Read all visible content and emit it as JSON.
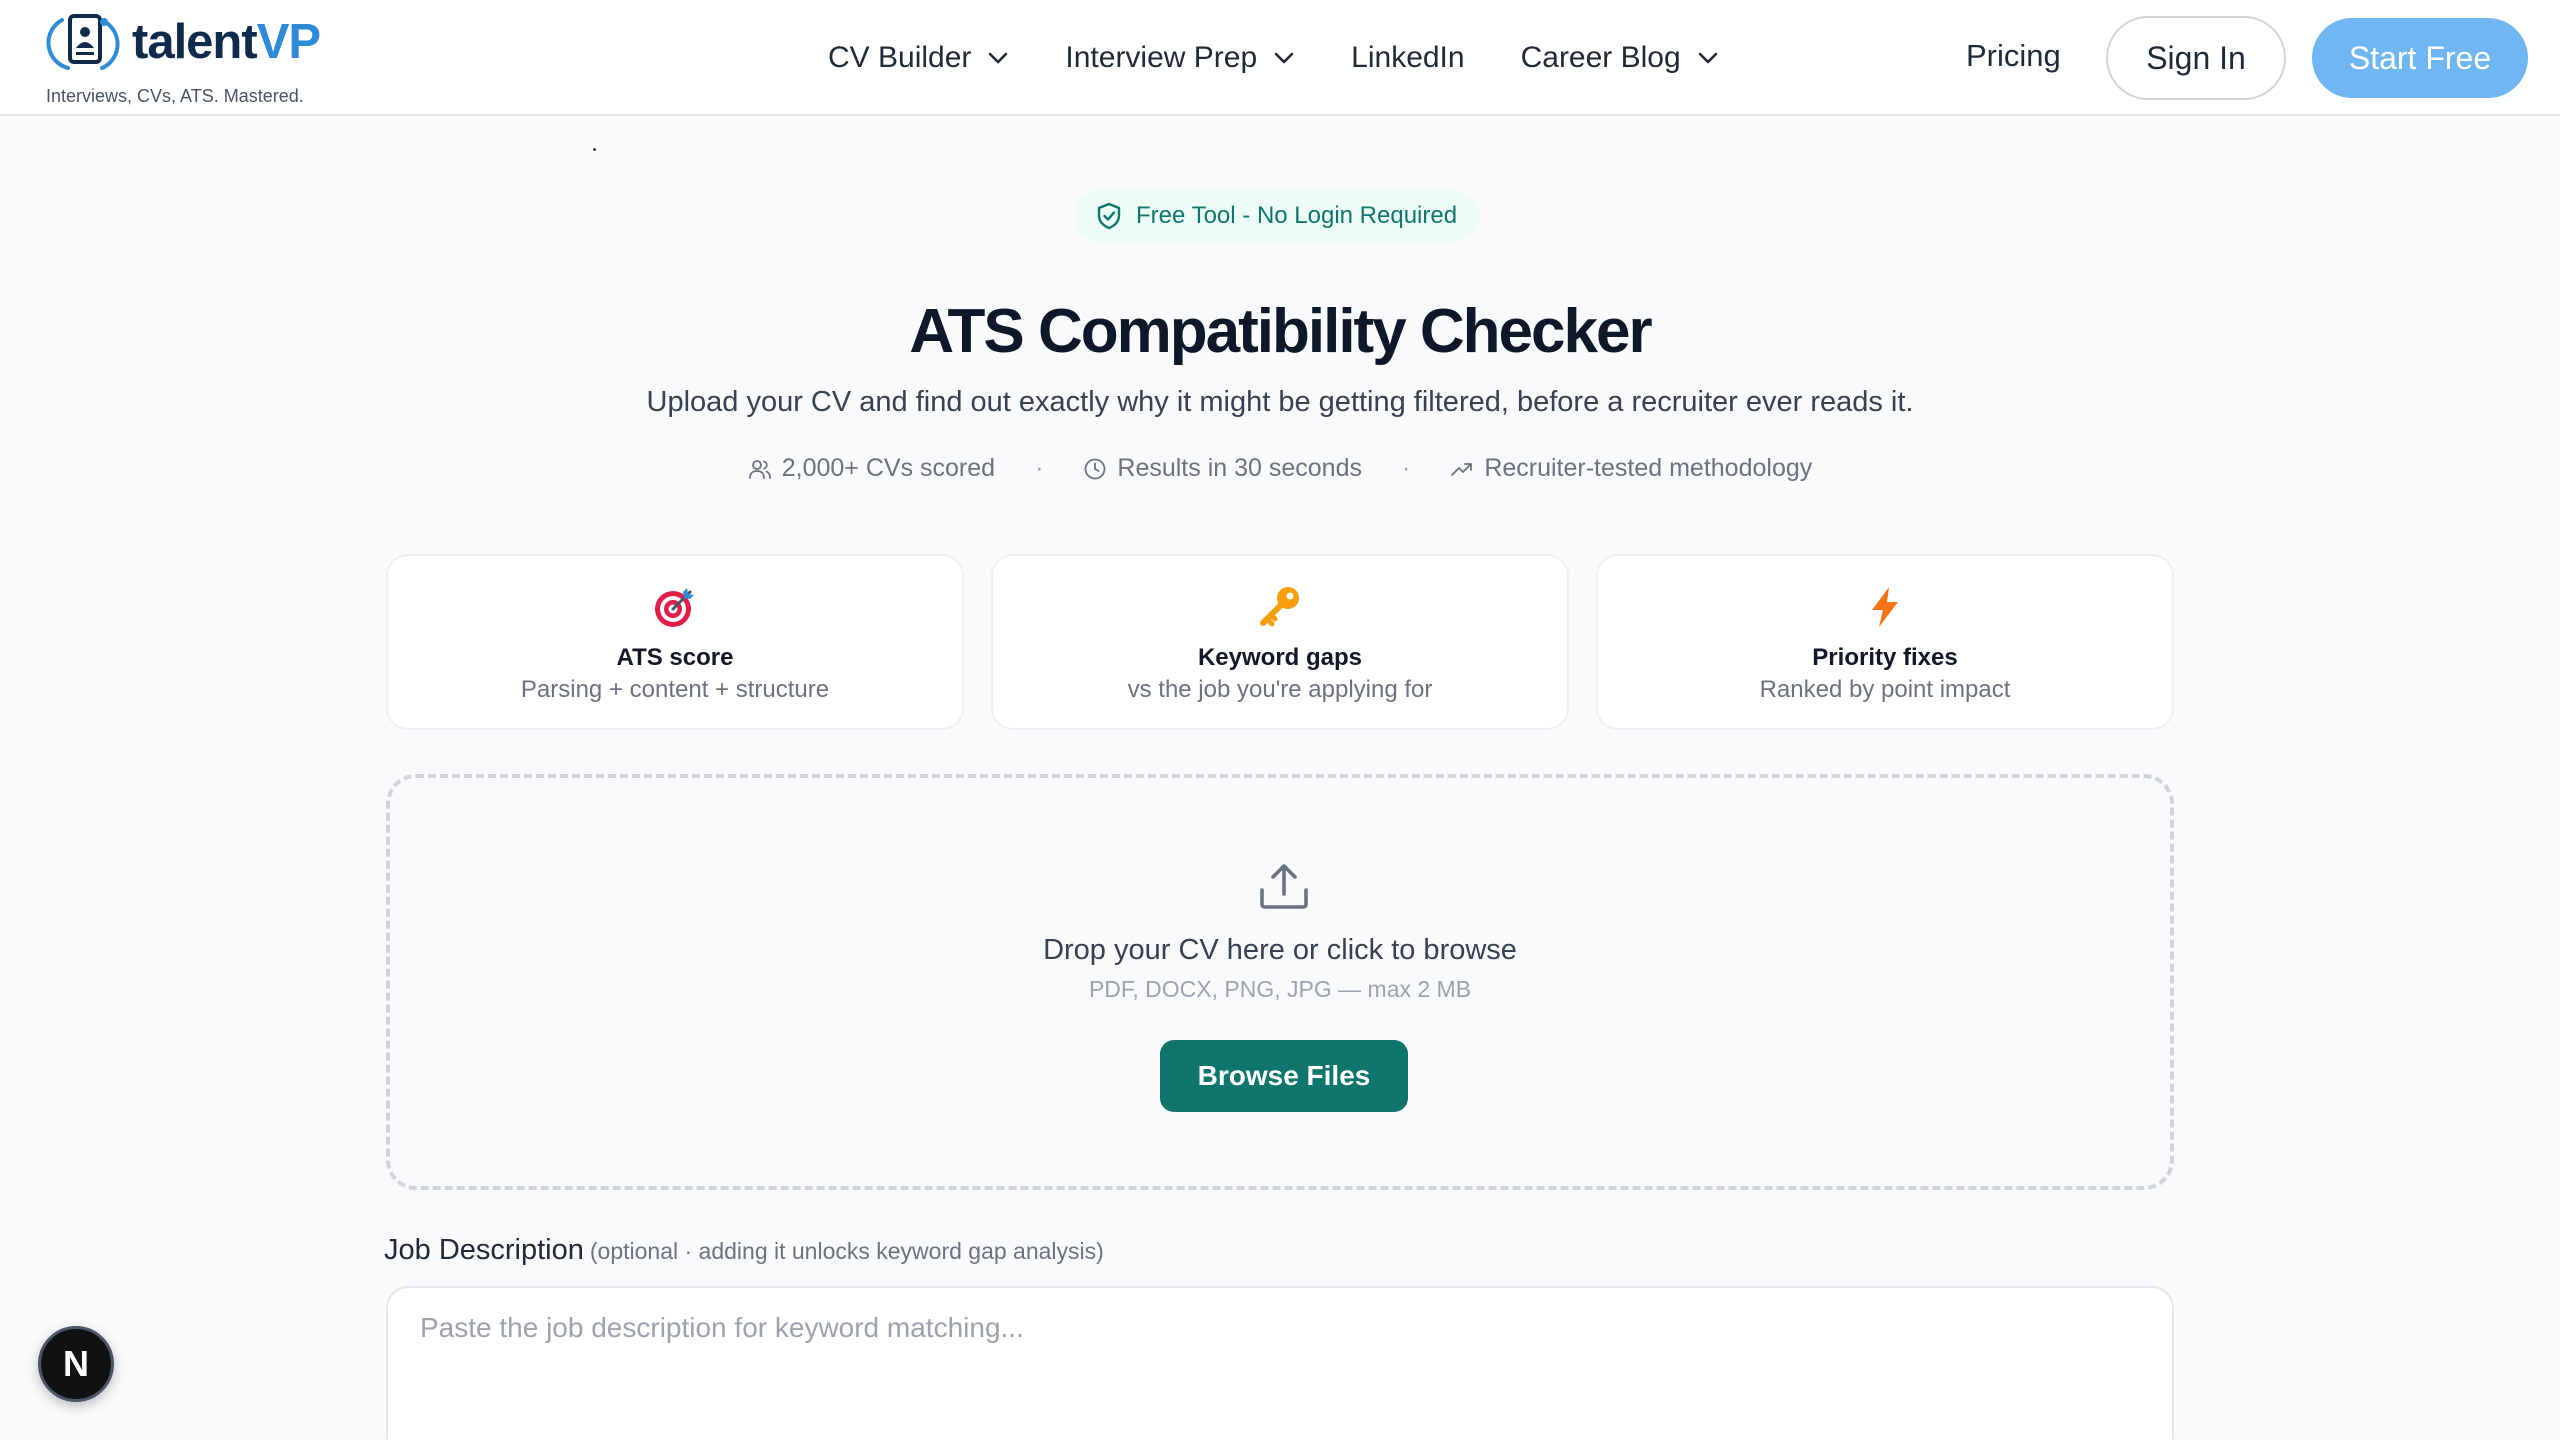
{
  "header": {
    "brand_part1": "talent",
    "brand_part2": "VP",
    "tagline": "Interviews, CVs, ATS. Mastered.",
    "nav": [
      {
        "label": "CV Builder"
      },
      {
        "label": "Interview Prep"
      },
      {
        "label": "LinkedIn"
      },
      {
        "label": "Career Blog"
      }
    ],
    "pricing": "Pricing",
    "sign_in": "Sign In",
    "start_free": "Start Free"
  },
  "hero": {
    "badge": "Free Tool - No Login Required",
    "title": "ATS Compatibility Checker",
    "subtitle": "Upload your CV and find out exactly why it might be getting filtered, before a recruiter ever reads it.",
    "stats": [
      {
        "icon": "users-icon",
        "text": "2,000+ CVs scored"
      },
      {
        "icon": "clock-icon",
        "text": "Results in 30 seconds"
      },
      {
        "icon": "trending-up-icon",
        "text": "Recruiter-tested methodology"
      }
    ],
    "separator": "·"
  },
  "features": [
    {
      "icon": "target-icon",
      "title": "ATS score",
      "subtitle": "Parsing + content + structure"
    },
    {
      "icon": "key-icon",
      "title": "Keyword gaps",
      "subtitle": "vs the job you're applying for"
    },
    {
      "icon": "lightning-icon",
      "title": "Priority fixes",
      "subtitle": "Ranked by point impact"
    }
  ],
  "upload": {
    "title": "Drop your CV here or click to browse",
    "subtitle": "PDF, DOCX, PNG, JPG — max 2 MB",
    "button": "Browse Files"
  },
  "job_description": {
    "label": "Job Description",
    "note": "(optional · adding it unlocks keyword gap analysis)",
    "placeholder": "Paste the job description for keyword matching..."
  },
  "floating": {
    "label": "N"
  },
  "colors": {
    "brand_dark": "#0f2a4a",
    "brand_blue": "#2f8bd8",
    "start_free_bg": "#6fb6f2",
    "teal": "#0f766e"
  }
}
